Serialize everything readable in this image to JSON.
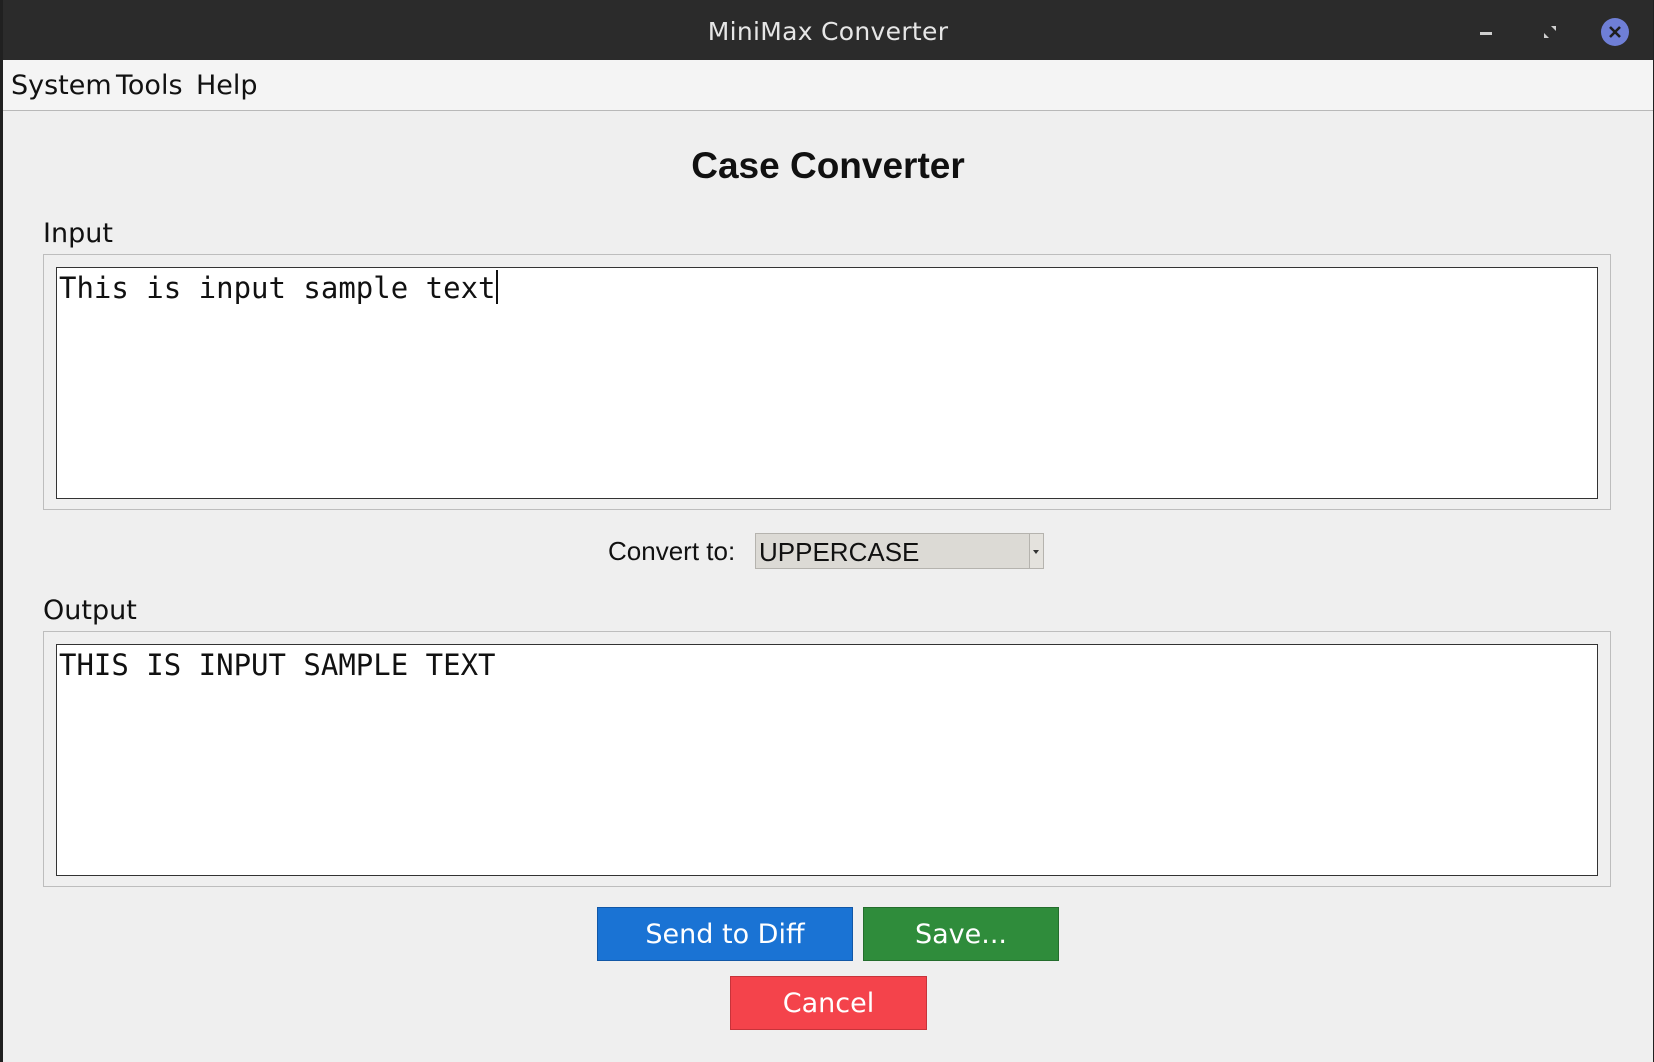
{
  "window": {
    "title": "MiniMax Converter",
    "controls": [
      "minimize-icon",
      "maximize-icon",
      "close-icon"
    ]
  },
  "menu": {
    "items": [
      "System",
      "Tools",
      "Help"
    ]
  },
  "main": {
    "heading": "Case Converter",
    "input": {
      "label": "Input",
      "value": "This is input sample text"
    },
    "convert": {
      "label": "Convert to:",
      "selected": "UPPERCASE"
    },
    "output": {
      "label": "Output",
      "value": "THIS IS INPUT SAMPLE TEXT"
    }
  },
  "buttons": {
    "send_to_diff": "Send to Diff",
    "save": "Save...",
    "cancel": "Cancel"
  },
  "colors": {
    "send_to_diff": "#1a73d4",
    "save": "#2f8c3b",
    "cancel": "#f4434b",
    "close_button": "#6f7fd6"
  }
}
